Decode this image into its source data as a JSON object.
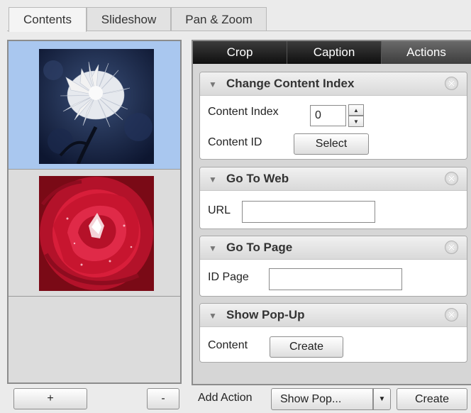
{
  "top_tabs": [
    "Contents",
    "Slideshow",
    "Pan & Zoom"
  ],
  "left": {
    "add_label": "+",
    "remove_label": "-"
  },
  "right": {
    "sub_tabs": [
      "Crop",
      "Caption",
      "Actions"
    ],
    "cards": {
      "change_index": {
        "title": "Change Content Index",
        "index_label": "Content Index",
        "index_value": "0",
        "id_label": "Content ID",
        "select_label": "Select"
      },
      "go_web": {
        "title": "Go To Web",
        "url_label": "URL",
        "url_value": ""
      },
      "go_page": {
        "title": "Go To Page",
        "id_label": "ID Page",
        "id_value": ""
      },
      "popup": {
        "title": "Show Pop-Up",
        "content_label": "Content",
        "create_label": "Create"
      }
    },
    "footer": {
      "add_action_label": "Add Action",
      "select_value": "Show Pop...",
      "create_label": "Create"
    }
  },
  "icons": {
    "collapse": "▼",
    "close": "✕",
    "spin_up": "▲",
    "spin_down": "▼",
    "dropdown": "▼"
  }
}
